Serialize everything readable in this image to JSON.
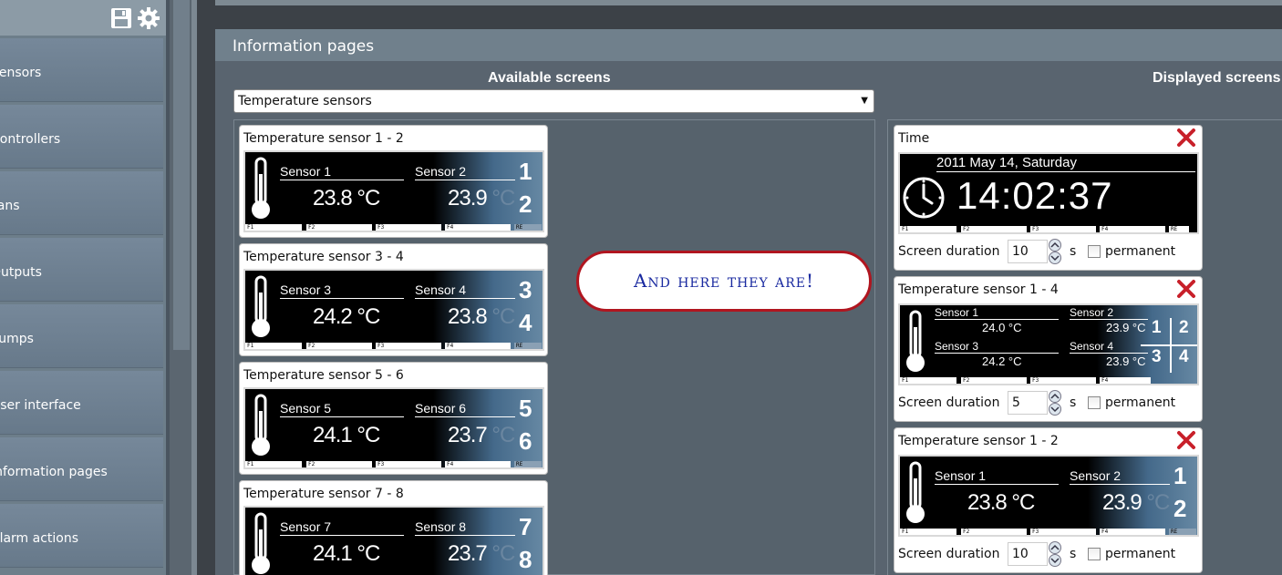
{
  "sidebar": {
    "items": [
      {
        "label": "Sensors"
      },
      {
        "label": "Controllers"
      },
      {
        "label": "Fans"
      },
      {
        "label": "Outputs"
      },
      {
        "label": "Pumps"
      },
      {
        "label": "User interface"
      },
      {
        "label": "Information pages"
      },
      {
        "label": "Alarm actions"
      }
    ]
  },
  "panel": {
    "title": "Information pages"
  },
  "available": {
    "title": "Available screens",
    "selected": "Temperature sensors",
    "cards": [
      {
        "title": "Temperature sensor 1 - 2",
        "s1": "Sensor 1",
        "s2": "Sensor 2",
        "v1": "23.8 °C",
        "v2": "23.9",
        "n1": "1",
        "n2": "2"
      },
      {
        "title": "Temperature sensor 3 - 4",
        "s1": "Sensor 3",
        "s2": "Sensor 4",
        "v1": "24.2 °C",
        "v2": "23.8",
        "n1": "3",
        "n2": "4"
      },
      {
        "title": "Temperature sensor 5 - 6",
        "s1": "Sensor 5",
        "s2": "Sensor 6",
        "v1": "24.1 °C",
        "v2": "23.7",
        "n1": "5",
        "n2": "6"
      },
      {
        "title": "Temperature sensor 7 - 8",
        "s1": "Sensor 7",
        "s2": "Sensor 8",
        "v1": "24.1 °C",
        "v2": "23.7",
        "n1": "7",
        "n2": "8"
      }
    ]
  },
  "displayed": {
    "title": "Displayed screens",
    "duration_label": "Screen duration",
    "seconds_label": "s",
    "permanent_label": "permanent",
    "time_card": {
      "title": "Time",
      "date": "2011 May 14, Saturday",
      "time": "14:02:37",
      "duration": "10"
    },
    "quad_card": {
      "title": "Temperature sensor 1 - 4",
      "s1": "Sensor 1",
      "s2": "Sensor 2",
      "s3": "Sensor 3",
      "s4": "Sensor 4",
      "v1": "24.0 °C",
      "v2": "23.9 °C",
      "v3": "24.2 °C",
      "v4": "23.9 °C",
      "n1": "1",
      "n2": "2",
      "n3": "3",
      "n4": "4",
      "duration": "5"
    },
    "pair_card": {
      "title": "Temperature sensor 1 - 2",
      "s1": "Sensor 1",
      "s2": "Sensor 2",
      "v1": "23.8 °C",
      "v2": "23.9",
      "n1": "1",
      "n2": "2",
      "duration": "10"
    }
  },
  "lcd_footer": {
    "f1": "F1",
    "f2": "F2",
    "f3": "F3",
    "f4": "F4",
    "re": "RE"
  },
  "unit_faded": "°C",
  "callout": {
    "text": "And here they are!"
  },
  "colors": {
    "accent_red": "#c8202a",
    "callout_text": "#1a2aa0",
    "panel_bg": "#59646f"
  },
  "icons": [
    "save-icon",
    "gear-icon",
    "close-icon",
    "thermometer-icon",
    "clock-icon",
    "spinner-up-icon",
    "spinner-down-icon",
    "dropdown-arrow-icon"
  ]
}
